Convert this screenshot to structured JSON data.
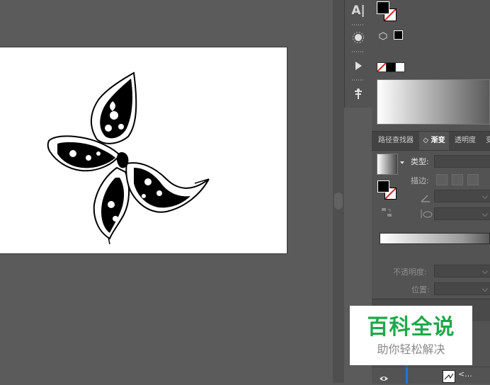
{
  "toolbar_strip": {
    "items": [
      {
        "icon": "character-panel-icon",
        "label": "A|"
      },
      {
        "icon": "brush-panel-icon"
      },
      {
        "icon": "actions-play-icon"
      },
      {
        "icon": "puppet-warp-icon"
      }
    ]
  },
  "color_panel": {
    "fill_color": "#000000",
    "stroke": "none"
  },
  "appearance": {
    "chip": "■"
  },
  "tabs": [
    {
      "label": "路径查找器",
      "active": false
    },
    {
      "label": "◇ 渐变",
      "active": true
    },
    {
      "label": "透明度",
      "active": false
    },
    {
      "label": "变",
      "active": false
    }
  ],
  "gradient_panel": {
    "type_label": "类型:",
    "stroke_label": "描边:",
    "opacity_label": "不透明度:",
    "position_label": "位置:",
    "slider_start_color": "#ffffff",
    "slider_end_color": "#5a5a5a"
  },
  "layers": {
    "row_name": "<..."
  },
  "watermark": {
    "title": "百科全说",
    "subtitle": "助你轻松解决",
    "color": "#1fa84b"
  }
}
